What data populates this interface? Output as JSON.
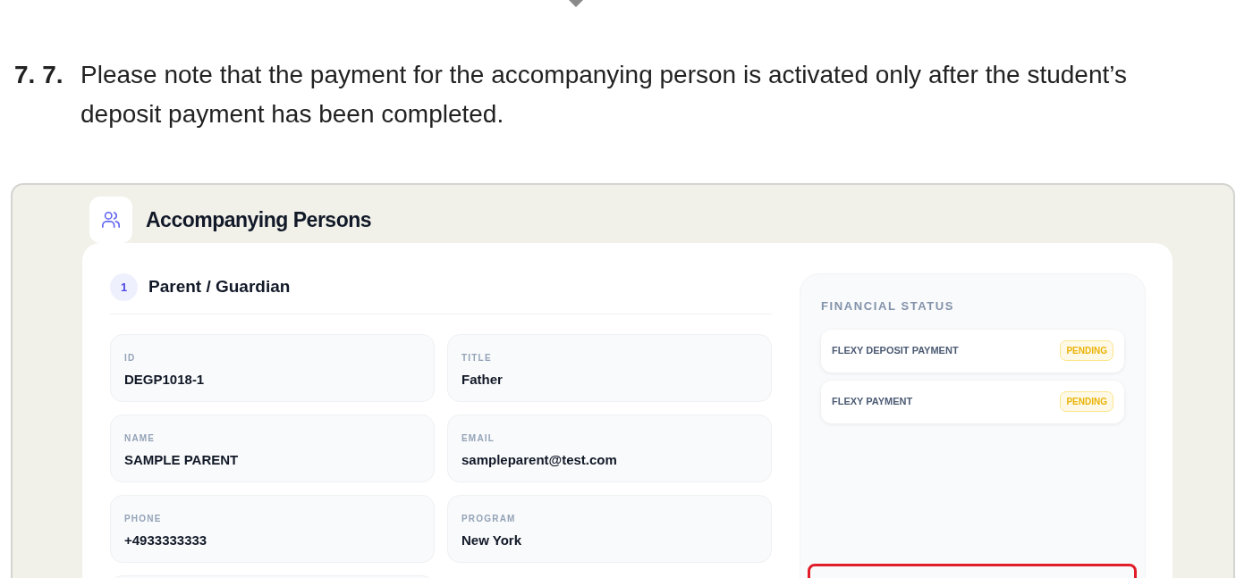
{
  "note": {
    "number": "7. 7.",
    "text": "Please note that the payment for the accompanying person is activated only after the student’s deposit payment has been completed."
  },
  "panel": {
    "title": "Accompanying Persons",
    "person": {
      "index": "1",
      "heading": "Parent / Guardian",
      "fields": [
        {
          "label": "ID",
          "value": "DEGP1018-1"
        },
        {
          "label": "TITLE",
          "value": "Father"
        },
        {
          "label": "NAME",
          "value": "SAMPLE PARENT"
        },
        {
          "label": "EMAIL",
          "value": "sampleparent@test.com"
        },
        {
          "label": "PHONE",
          "value": "+4933333333"
        },
        {
          "label": "PROGRAM",
          "value": "New York"
        }
      ]
    },
    "financial_status": {
      "title": "FINANCIAL STATUS",
      "items": [
        {
          "name": "FLEXY DEPOSIT PAYMENT",
          "status": "PENDING"
        },
        {
          "name": "FLEXY PAYMENT",
          "status": "PENDING"
        }
      ]
    }
  }
}
